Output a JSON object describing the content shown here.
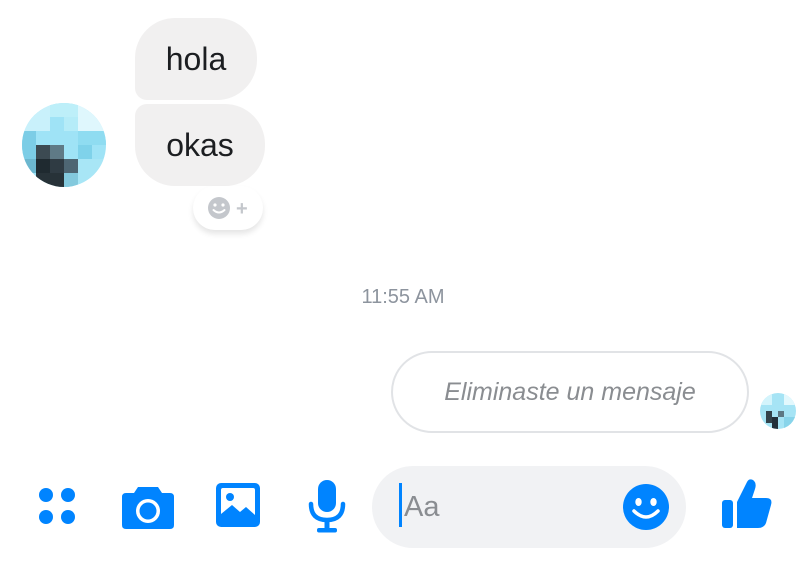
{
  "conversation": {
    "incoming_messages": [
      {
        "text": "hola"
      },
      {
        "text": "okas"
      }
    ],
    "reaction_button": {
      "icon": "add-reaction-icon",
      "plus": "+"
    },
    "timestamp": "11:55 AM",
    "outgoing_deleted": {
      "text": "Eliminaste un mensaje"
    }
  },
  "composer": {
    "placeholder": "Aa",
    "toolbar_icons": [
      "more-options-icon",
      "camera-icon",
      "gallery-icon",
      "microphone-icon"
    ],
    "emoji_icon": "emoji-icon",
    "like_icon": "thumbs-up-icon"
  },
  "colors": {
    "accent": "#0084ff",
    "incoming_bubble": "#f1f0f0",
    "composer_bg": "#f1f2f4",
    "muted_text": "#8a8d91"
  }
}
